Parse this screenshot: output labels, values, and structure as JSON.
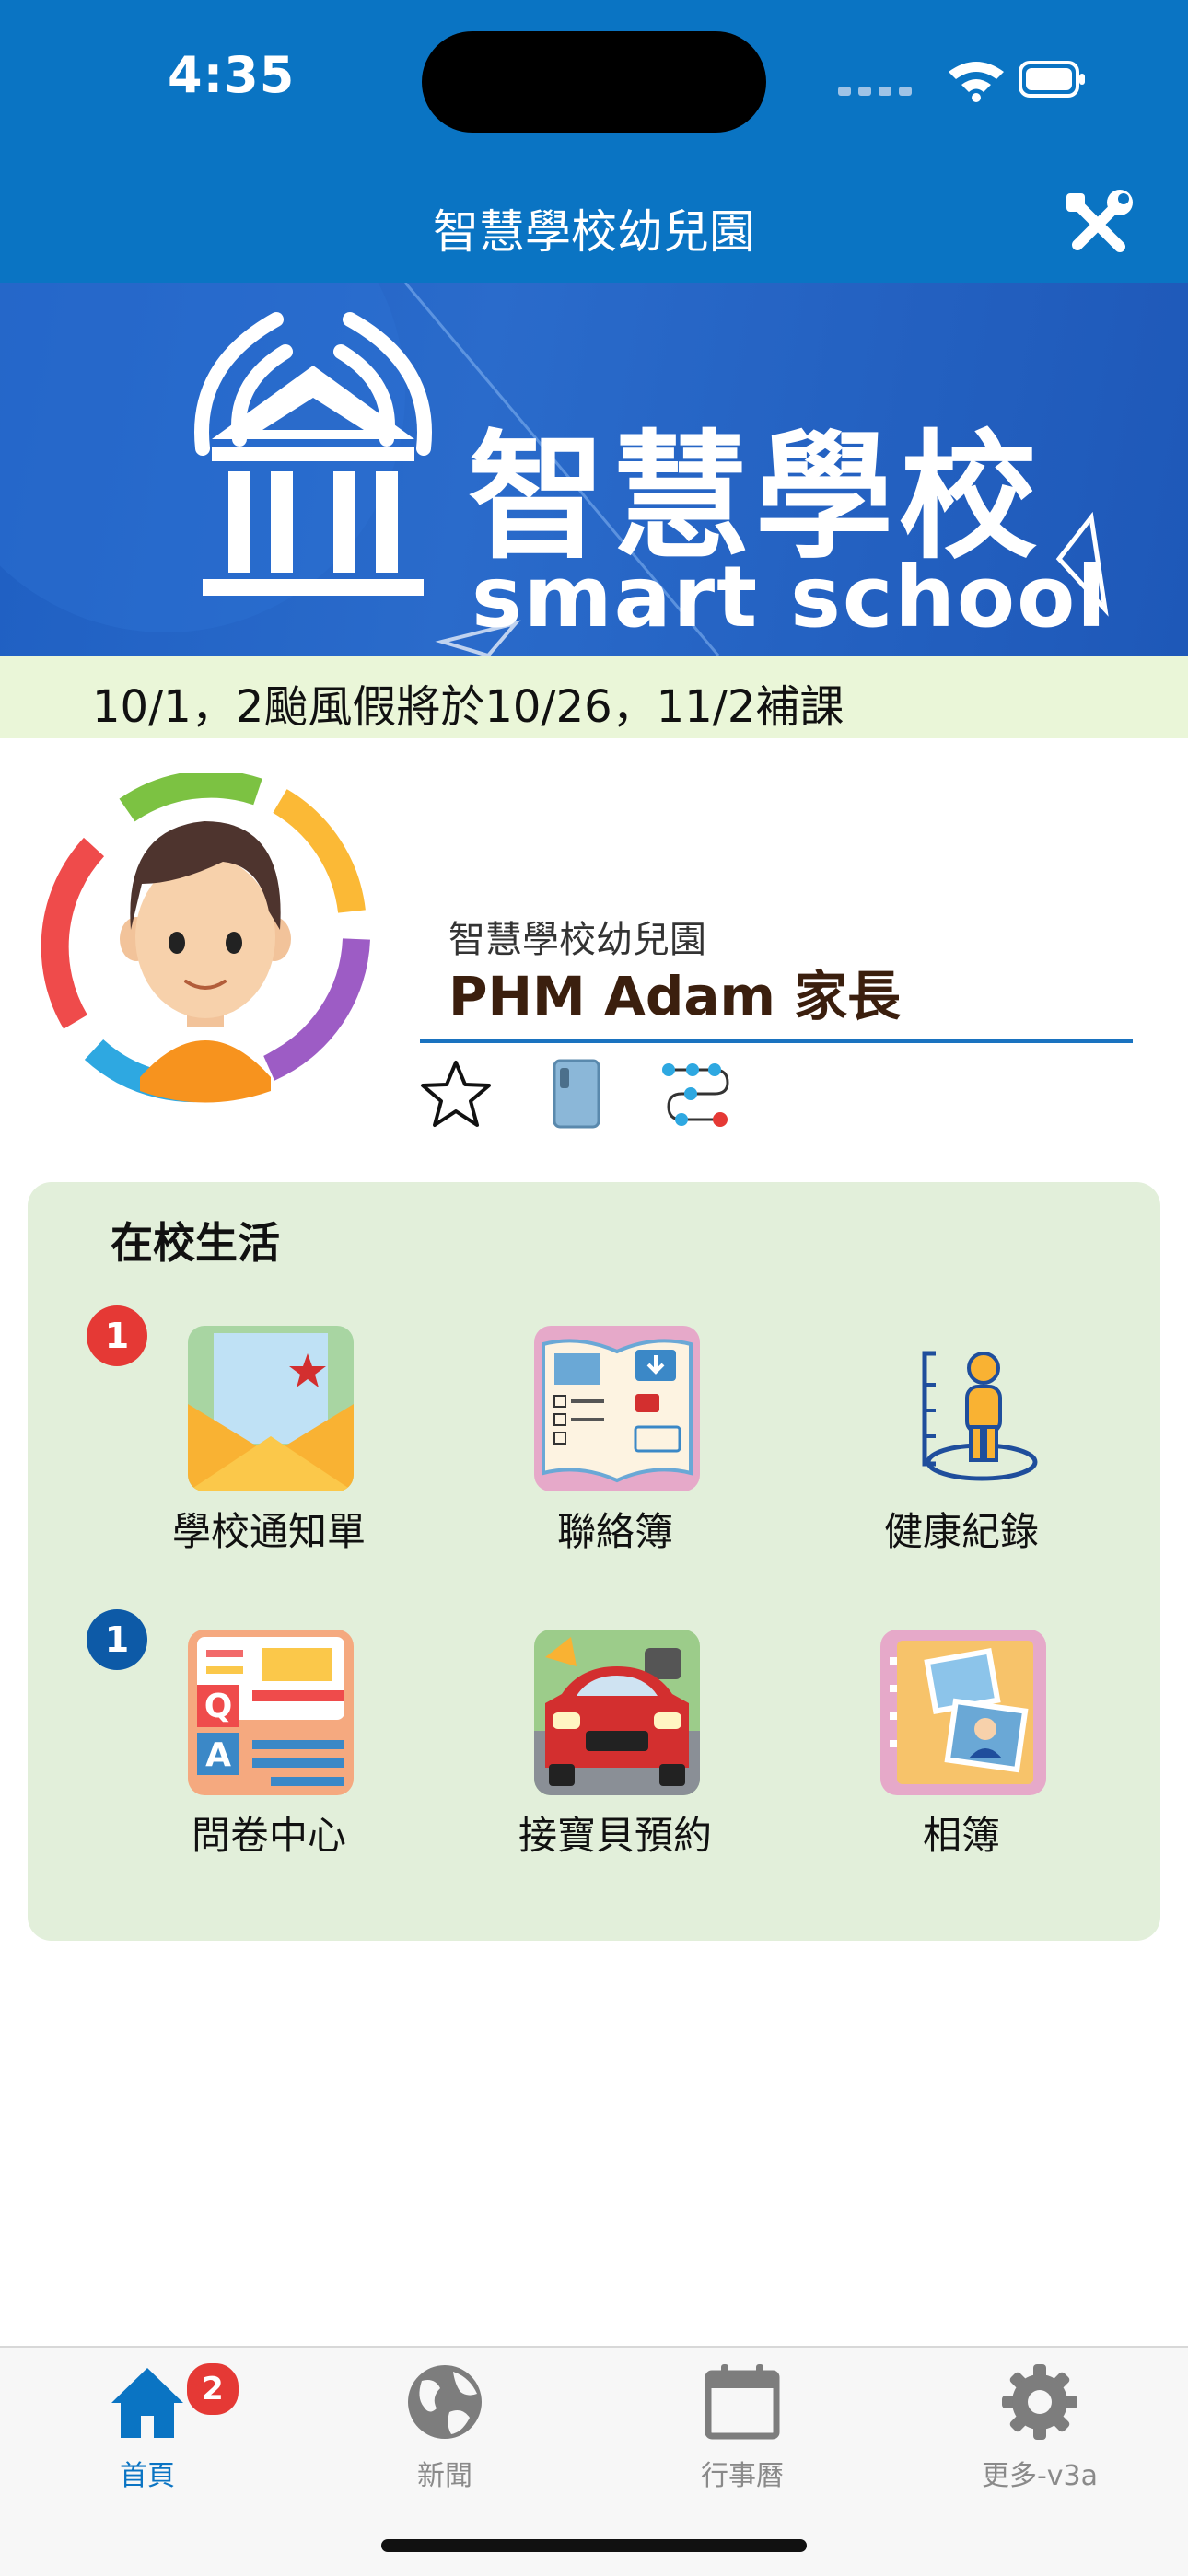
{
  "status_bar": {
    "time": "4:35"
  },
  "nav": {
    "title": "智慧學校幼兒園"
  },
  "banner": {
    "title": "智慧學校",
    "subtitle": "smart school"
  },
  "announcement": {
    "text": "10/1，2颱風假將於10/26，11/2補課"
  },
  "profile": {
    "school": "智慧學校幼兒園",
    "name": "PHM Adam 家長"
  },
  "school_life": {
    "title": "在校生活",
    "items": [
      {
        "label": "學校通知單",
        "badge": "1",
        "badge_color": "#e53935"
      },
      {
        "label": "聯絡簿"
      },
      {
        "label": "健康紀錄"
      },
      {
        "label": "問卷中心",
        "badge": "1",
        "badge_color": "#0d5aa7"
      },
      {
        "label": "接寶貝預約"
      },
      {
        "label": "相簿"
      }
    ]
  },
  "tabbar": {
    "tabs": [
      {
        "label": "首頁",
        "icon": "home-icon",
        "badge": "2",
        "active": true
      },
      {
        "label": "新聞",
        "icon": "globe-icon"
      },
      {
        "label": "行事曆",
        "icon": "calendar-icon"
      },
      {
        "label": "更多-v3a",
        "icon": "gear-icon"
      }
    ]
  },
  "colors": {
    "primary": "#0a74c3",
    "card_bg": "#e2efda",
    "announce_bg": "#eaf6d8",
    "badge_red": "#e53935",
    "badge_blue": "#0d5aa7"
  }
}
